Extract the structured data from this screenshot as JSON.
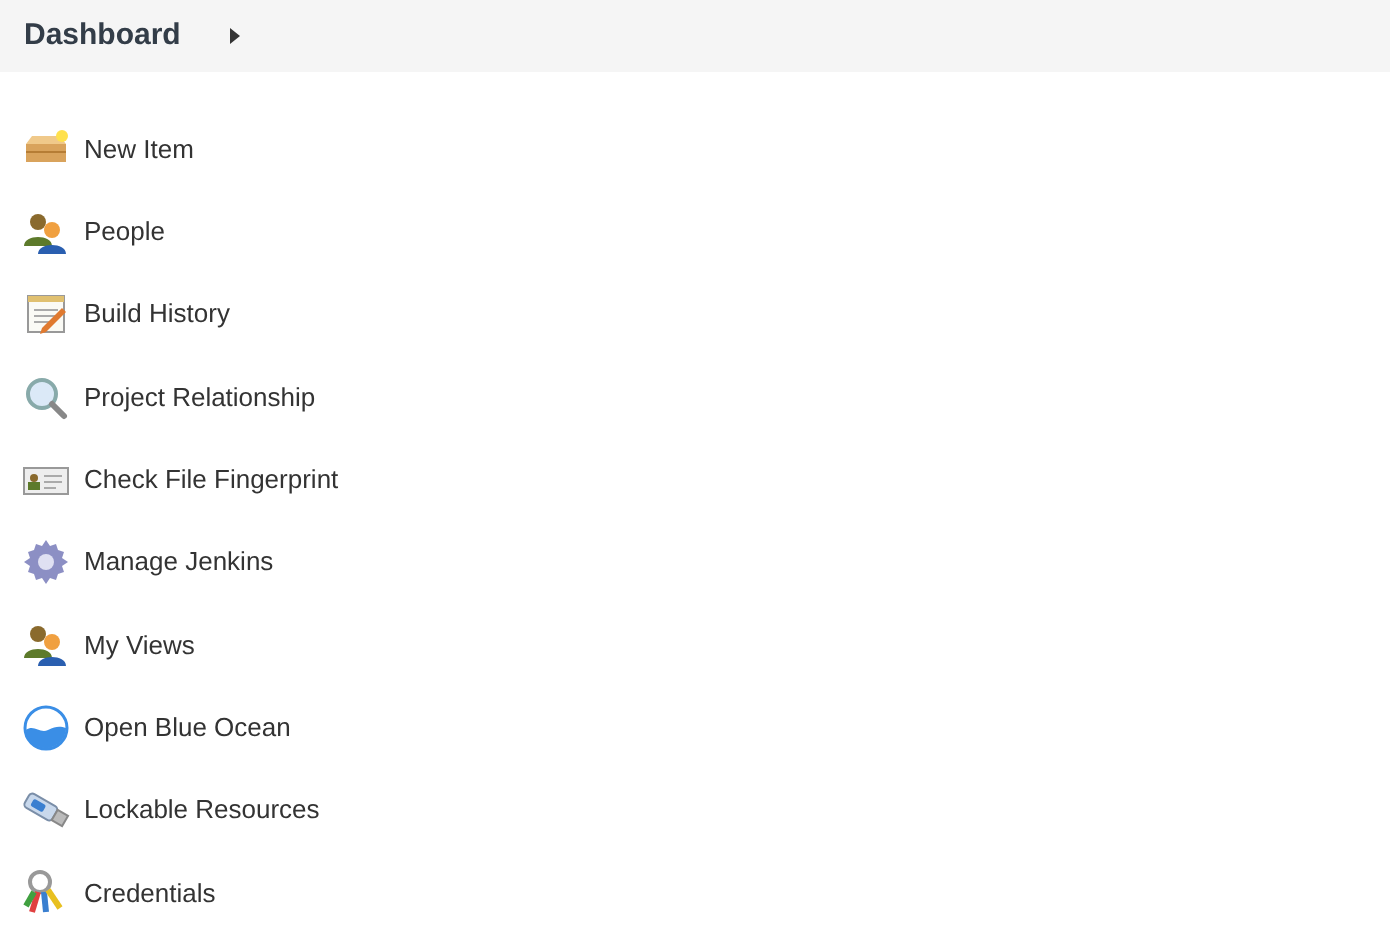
{
  "breadcrumb": {
    "label": "Dashboard"
  },
  "tasks": [
    {
      "label": "New Item",
      "kind": "box"
    },
    {
      "label": "People",
      "kind": "people"
    },
    {
      "label": "Build History",
      "kind": "notepad"
    },
    {
      "label": "Project Relationship",
      "kind": "magnifier"
    },
    {
      "label": "Check File Fingerprint",
      "kind": "card"
    },
    {
      "label": "Manage Jenkins",
      "kind": "gear"
    },
    {
      "label": "My Views",
      "kind": "people"
    },
    {
      "label": "Open Blue Ocean",
      "kind": "ocean"
    },
    {
      "label": "Lockable Resources",
      "kind": "usb"
    },
    {
      "label": "Credentials",
      "kind": "keys"
    }
  ]
}
